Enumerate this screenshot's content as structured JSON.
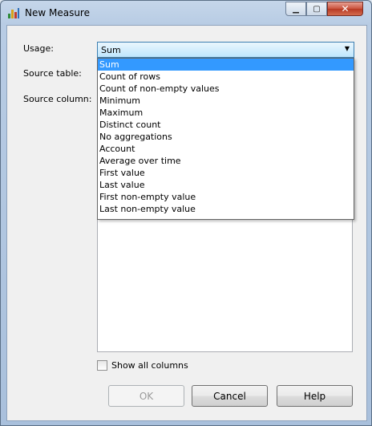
{
  "window": {
    "title": "New Measure",
    "minimize_glyph": "▁",
    "maximize_glyph": "▢",
    "close_glyph": "✕"
  },
  "form": {
    "usage_label": "Usage:",
    "source_table_label": "Source table:",
    "source_column_label": "Source column:",
    "usage_value": "Sum",
    "usage_options": [
      "Sum",
      "Count of rows",
      "Count of non-empty values",
      "Minimum",
      "Maximum",
      "Distinct count",
      "No aggregations",
      "Account",
      "Average over time",
      "First value",
      "Last value",
      "First non-empty value",
      "Last non-empty value"
    ],
    "show_all_columns_label": "Show all columns",
    "show_all_columns_checked": false
  },
  "buttons": {
    "ok": "OK",
    "cancel": "Cancel",
    "help": "Help"
  },
  "colors": {
    "selection": "#3399ff",
    "combo_border": "#3c7fb1"
  },
  "icons": {
    "app": "bar-chart-icon",
    "dropdown": "chevron-down-icon"
  }
}
